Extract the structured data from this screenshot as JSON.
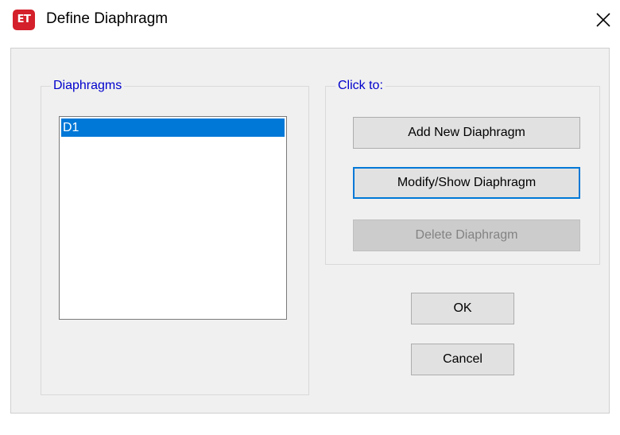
{
  "window": {
    "app_icon_text": "ET",
    "title": "Define Diaphragm",
    "close_symbol": "✕"
  },
  "diaphragms_group": {
    "label": "Diaphragms",
    "items": [
      "D1"
    ],
    "selected_index": 0
  },
  "click_to_group": {
    "label": "Click to:",
    "add_label": "Add New Diaphragm",
    "modify_label": "Modify/Show Diaphragm",
    "delete_label": "Delete Diaphragm"
  },
  "buttons": {
    "ok_label": "OK",
    "cancel_label": "Cancel"
  },
  "colors": {
    "selection": "#0078d7",
    "group_label": "#0000cc",
    "app_icon": "#d4202a"
  },
  "icons": {
    "app": "etabs-app-icon",
    "close": "close-icon"
  }
}
